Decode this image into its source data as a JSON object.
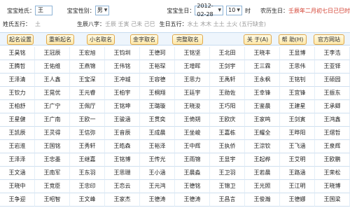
{
  "form": {
    "surname_label": "宝宝姓氏：",
    "surname_value": "王",
    "gender_label": "宝宝性别：",
    "gender_value": "男",
    "birth_label": "宝宝生日：",
    "birth_date": "2012-02-28",
    "birth_hour": "10",
    "hour_suffix": "时",
    "lunar_label": "农历生日：",
    "lunar_value": "壬辰年二月初七日己巳时",
    "wuxing_label": "姓氏五行：",
    "wuxing_value": "土",
    "bazi_label": "生辰八字：",
    "bazi_value": "壬辰 壬寅 己未 己巳",
    "birth_wuxing_label": "生日五行：",
    "birth_wuxing_value": "水土 木木 土土 土火 (五行缺金)"
  },
  "toolbar": {
    "settings": "起名设置",
    "regen": "重新起名",
    "xiaoming": "小名取名",
    "jinzi": "金字取名",
    "fullname": "完整取名",
    "about": "关 于(A)",
    "help": "帮 助(H)",
    "website": "官方网站"
  },
  "names": [
    [
      "王昊铭",
      "王冠辰",
      "王宏旭",
      "王钧圳",
      "王德珂",
      "王铭坚",
      "王北田",
      "王晓丰",
      "王显博",
      "王李浩"
    ],
    [
      "王腾哲",
      "王佑维",
      "王燕锦",
      "王伟铭",
      "王裕琛",
      "王增晖",
      "王剑宇",
      "王三霖",
      "王思伟",
      "王亚铎"
    ],
    [
      "王泽清",
      "王人鑫",
      "王宝深",
      "王冲城",
      "王容德",
      "王思力",
      "王禹轩",
      "王永枫",
      "王铭钊",
      "王硕园"
    ],
    [
      "王钦力",
      "王晃优",
      "王元睿",
      "王柏宇",
      "王桐翔",
      "王廷宇",
      "王勋佐",
      "王幸锋",
      "王宜锋",
      "王振东"
    ],
    [
      "王柏舒",
      "王广宁",
      "王佩厅",
      "王铭坤",
      "王璐璇",
      "王晓浚",
      "王巧阳",
      "王鉴晨",
      "王建星",
      "王承卿"
    ],
    [
      "王星健",
      "王广南",
      "王欧一",
      "王骏涵",
      "王贯奕",
      "王倚朔",
      "王欧庆",
      "王家鸣",
      "王剑寅",
      "王鸿鑫"
    ],
    [
      "王凯辰",
      "王灵得",
      "王信弥",
      "王音辰",
      "王成晨",
      "王坐峻",
      "王嘉栋",
      "王耀全",
      "王晔阳",
      "王熠哲"
    ],
    [
      "王岩淮",
      "王国铭",
      "王秀轩",
      "王皓森",
      "王裕泽",
      "王中辉",
      "王执侨",
      "王淙钦",
      "王飞涵",
      "王泉辉"
    ],
    [
      "王泽泽",
      "王忠墨",
      "王继嘉",
      "王铭博",
      "王传光",
      "王雨锦",
      "王显宇",
      "王起桦",
      "王艾明",
      "王欧鹏"
    ],
    [
      "王文涵",
      "王南军",
      "王东羽",
      "王思珊",
      "王小涵",
      "王晨淼",
      "王卫羽",
      "王若晨",
      "王路涵",
      "王荣松"
    ],
    [
      "王晓中",
      "王竞臣",
      "王忠印",
      "王恋云",
      "王元鸿",
      "王德铭",
      "王锦卫",
      "王光照",
      "王江明",
      "王晓博"
    ],
    [
      "王争迎",
      "王昭智",
      "王文峰",
      "王家杰",
      "王德涛",
      "王德涛",
      "王昌言",
      "王俊瀚",
      "王德娜",
      "王国梁"
    ]
  ]
}
